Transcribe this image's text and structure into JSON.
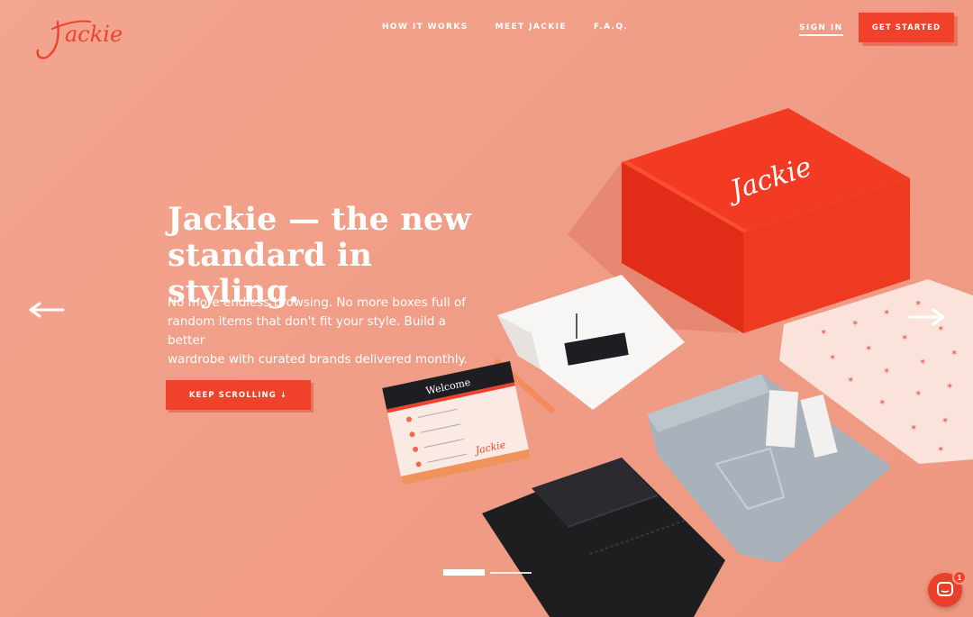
{
  "header": {
    "logo_text": "Jackie",
    "nav": [
      "HOW IT WORKS",
      "MEET JACKIE",
      "F.A.Q."
    ],
    "sign_in": "SIGN IN",
    "get_started": "GET STARTED"
  },
  "hero": {
    "headline_line1": "Jackie — the new",
    "headline_line2": "standard in styling.",
    "sub_line1": "No more endless browsing. No more boxes full of",
    "sub_line2": "random items that don't fit your style. Build a better",
    "sub_line3": "wardrobe with curated brands delivered monthly.",
    "cta": "KEEP SCROLLING ↓"
  },
  "product_art": {
    "box_logo": "Jackie",
    "card_title": "Welcome",
    "card_logo": "Jackie"
  },
  "carousel": {
    "slides": 2,
    "active": 1
  },
  "chat": {
    "badge_count": "1"
  },
  "colors": {
    "background": "#f2a08a",
    "accent": "#f0412b"
  }
}
